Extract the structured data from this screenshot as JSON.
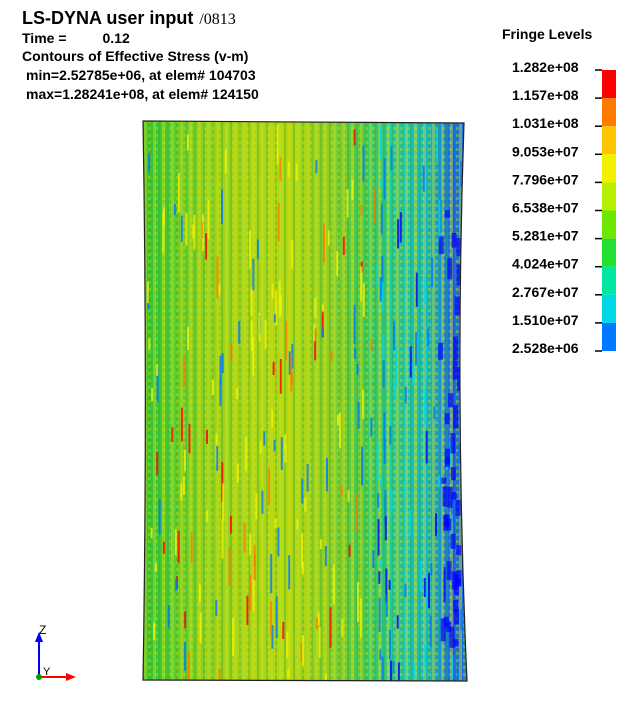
{
  "header": {
    "title": "LS-DYNA user input",
    "title_suffix": "/0813",
    "time_label": "Time =",
    "time_value": "0.12",
    "contour_label": "Contours of Effective Stress (v-m)",
    "min_text": "min=2.52785e+06, at elem# 104703",
    "max_text": "max=1.28241e+08, at elem# 124150"
  },
  "legend": {
    "title": "Fringe Levels",
    "levels": [
      {
        "label": "1.282e+08",
        "color": "#ff0000"
      },
      {
        "label": "1.157e+08",
        "color": "#ff7a00"
      },
      {
        "label": "1.031e+08",
        "color": "#ffc400"
      },
      {
        "label": "9.053e+07",
        "color": "#f2f200"
      },
      {
        "label": "7.796e+07",
        "color": "#b6f000"
      },
      {
        "label": "6.538e+07",
        "color": "#6ce800"
      },
      {
        "label": "5.281e+07",
        "color": "#22e030"
      },
      {
        "label": "4.024e+07",
        "color": "#00e8a0"
      },
      {
        "label": "2.767e+07",
        "color": "#00d8e6"
      },
      {
        "label": "1.510e+07",
        "color": "#0078ff"
      },
      {
        "label": "2.528e+06",
        "color": "#0000ff"
      }
    ]
  },
  "axes": {
    "z_label": "Z",
    "y_label": "Y",
    "z_color": "#0000ff",
    "x_color": "#ff0000",
    "y_color": "#00a000"
  }
}
